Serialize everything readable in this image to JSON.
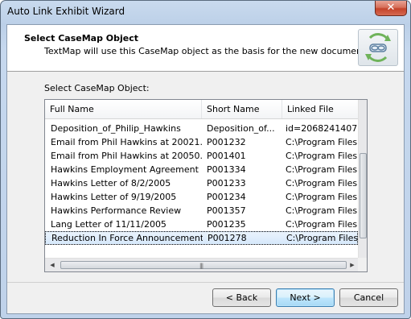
{
  "window": {
    "title": "Auto Link Exhibit Wizard",
    "close_symbol": "✕"
  },
  "header": {
    "title": "Select CaseMap Object",
    "subtitle": "TextMap will use this CaseMap object as the basis for the new document."
  },
  "list": {
    "label": "Select CaseMap Object:",
    "columns": [
      "Full Name",
      "Short Name",
      "Linked File"
    ],
    "rows": [
      {
        "full_name": "Deposition_of_Philip_Hawkins",
        "short_name": "Deposition_of...",
        "linked_file": "id=2068241407"
      },
      {
        "full_name": "Email from Phil Hawkins at 20021...",
        "short_name": "P001232",
        "linked_file": "C:\\Program Files"
      },
      {
        "full_name": "Email from Phil Hawkins at 20050...",
        "short_name": "P001401",
        "linked_file": "C:\\Program Files"
      },
      {
        "full_name": "Hawkins Employment Agreement",
        "short_name": "P001334",
        "linked_file": "C:\\Program Files"
      },
      {
        "full_name": "Hawkins Letter of 8/2/2005",
        "short_name": "P001233",
        "linked_file": "C:\\Program Files"
      },
      {
        "full_name": "Hawkins Letter of 9/19/2005",
        "short_name": "P001234",
        "linked_file": "C:\\Program Files"
      },
      {
        "full_name": "Hawkins Performance Review",
        "short_name": "P001357",
        "linked_file": "C:\\Program Files"
      },
      {
        "full_name": "Lang Letter of 11/11/2005",
        "short_name": "P001235",
        "linked_file": "C:\\Program Files"
      },
      {
        "full_name": "Reduction In Force Announcement",
        "short_name": "P001278",
        "linked_file": "C:\\Program Files"
      }
    ],
    "selected_index": 8
  },
  "buttons": {
    "back": "< Back",
    "next": "Next >",
    "cancel": "Cancel"
  },
  "colors": {
    "accent": "#3c7fb1",
    "selection": "#d6e8fb"
  }
}
